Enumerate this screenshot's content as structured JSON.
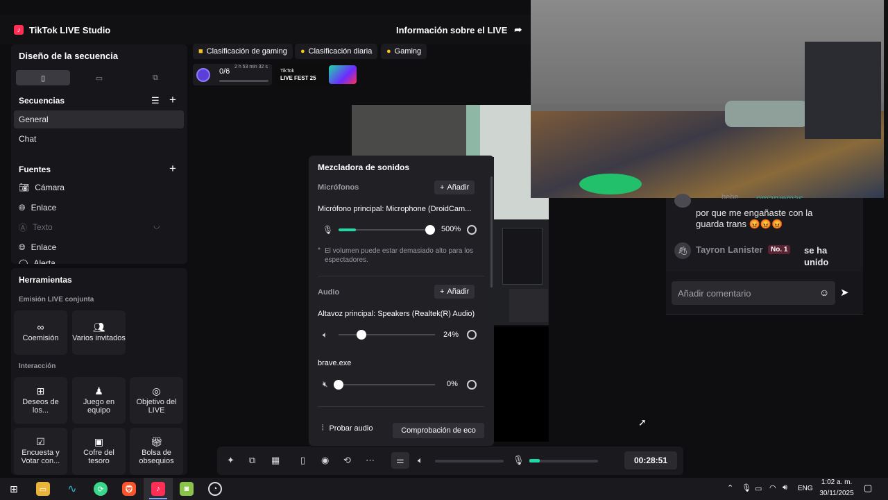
{
  "app": {
    "title": "TikTok LIVE Studio",
    "info_label": "Información sobre el LIVE"
  },
  "sidebar": {
    "layout_title": "Diseño de la secuencia",
    "scenes_title": "Secuencias",
    "scenes": [
      "General",
      "Chat"
    ],
    "sources_title": "Fuentes",
    "sources": [
      {
        "label": "Cámara",
        "icon": "camera-icon"
      },
      {
        "label": "Enlace",
        "icon": "globe-icon"
      },
      {
        "label": "Texto",
        "icon": "text-icon"
      },
      {
        "label": "Enlace",
        "icon": "globe-icon"
      },
      {
        "label": "Alerta",
        "icon": "alert-icon"
      }
    ]
  },
  "tools": {
    "title": "Herramientas",
    "joint_label": "Emisión LIVE conjunta",
    "joint": [
      "Coemisión",
      "Varios invitados"
    ],
    "interaction_label": "Interacción",
    "interaction": [
      "Deseos de los...",
      "Juego en equipo",
      "Objetivo del LIVE",
      "Encuesta y Votar con...",
      "Cofre del tesoro",
      "Bolsa de obsequios"
    ]
  },
  "chips": [
    "Clasificación de gaming",
    "Clasificación diaria",
    "Gaming"
  ],
  "progress": {
    "count": "0/6",
    "time": "2 h 53 min 32 s",
    "fill": 0
  },
  "banner": {
    "line1": "TikTok",
    "line2": "LIVE FEST 25"
  },
  "mixer": {
    "title": "Mezcladora de sonidos",
    "mics_label": "Micrófonos",
    "add_label": "Añadir",
    "mic_name": "Micrófono principal: Microphone (DroidCam...",
    "mic_value": "500%",
    "mic_level": 1.0,
    "warning": "El volumen puede estar demasiado alto para los espectadores.",
    "audio_label": "Audio",
    "speaker_name": "Altavoz principal: Speakers (Realtek(R) Audio)",
    "speaker_value": "24%",
    "speaker_level": 0.24,
    "app_name": "brave.exe",
    "app_value": "0%",
    "app_level": 0,
    "test_label": "Probar audio",
    "echo_label": "Comprobación de eco"
  },
  "chat": {
    "partial_user": "bebe",
    "partial_name": "omarvemas",
    "comment1": "por que me engañaste con la guarda trans 😡😡😡",
    "joiner_name": "Tayron Lanister",
    "joiner_badge": "No. 1",
    "joined_text": "se ha unido",
    "input_placeholder": "Añadir comentario"
  },
  "bottombar": {
    "timer": "00:28:51"
  },
  "taskbar": {
    "lang": "ENG",
    "time": "1:02 a. m.",
    "date": "30/11/2025"
  },
  "colors": {
    "accent": "#1fd8a8",
    "brand": "#ff2e55"
  }
}
